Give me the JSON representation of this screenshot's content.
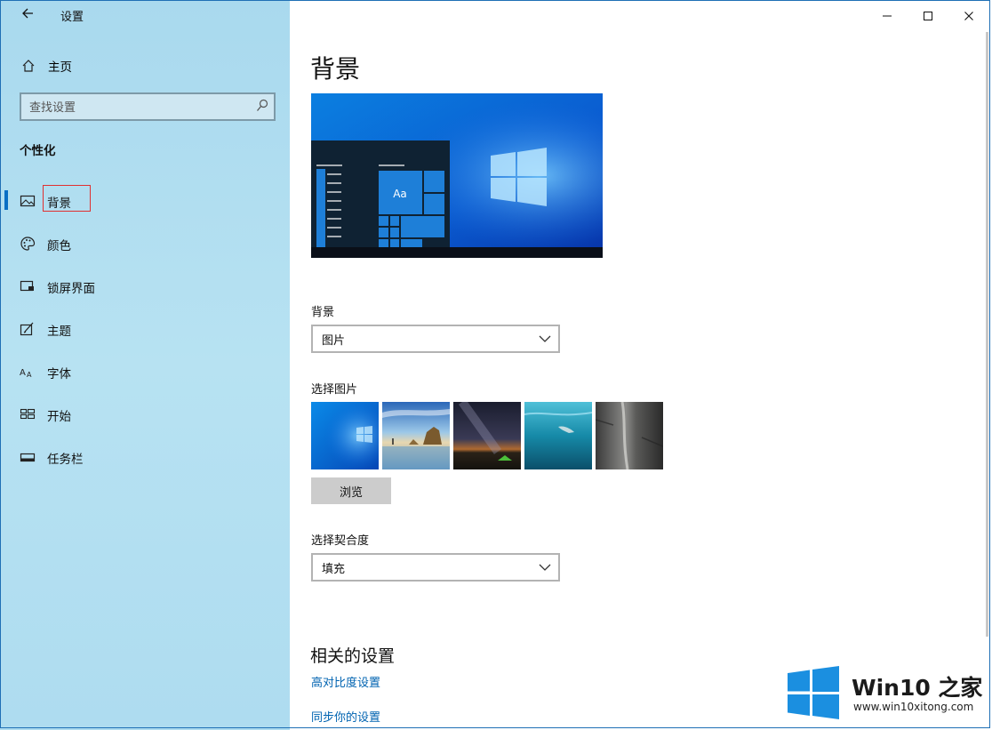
{
  "window": {
    "title": "设置",
    "back_icon": "arrow-left-icon",
    "controls": {
      "minimize": "─",
      "maximize": "☐",
      "close": "✕"
    }
  },
  "sidebar": {
    "home_label": "主页",
    "search_placeholder": "查找设置",
    "section_title": "个性化",
    "items": [
      {
        "label": "背景",
        "icon": "picture-icon",
        "active": true
      },
      {
        "label": "颜色",
        "icon": "palette-icon",
        "active": false
      },
      {
        "label": "锁屏界面",
        "icon": "lock-screen-icon",
        "active": false
      },
      {
        "label": "主题",
        "icon": "theme-icon",
        "active": false
      },
      {
        "label": "字体",
        "icon": "font-icon",
        "active": false
      },
      {
        "label": "开始",
        "icon": "start-icon",
        "active": false
      },
      {
        "label": "任务栏",
        "icon": "taskbar-icon",
        "active": false
      }
    ]
  },
  "main": {
    "title": "背景",
    "preview_tile_text": "Aa",
    "background_label": "背景",
    "background_value": "图片",
    "choose_picture_label": "选择图片",
    "browse_label": "浏览",
    "fit_label": "选择契合度",
    "fit_value": "填充",
    "related_title": "相关的设置",
    "links": [
      "高对比度设置",
      "同步你的设置"
    ]
  },
  "watermark": {
    "brand": "Win10 之家",
    "url": "www.win10xitong.com"
  },
  "colors": {
    "accent": "#0063b1",
    "selection_bar": "#0a6fc4",
    "highlight_box": "#e03030",
    "sidebar_bg": "#b2dff1"
  }
}
